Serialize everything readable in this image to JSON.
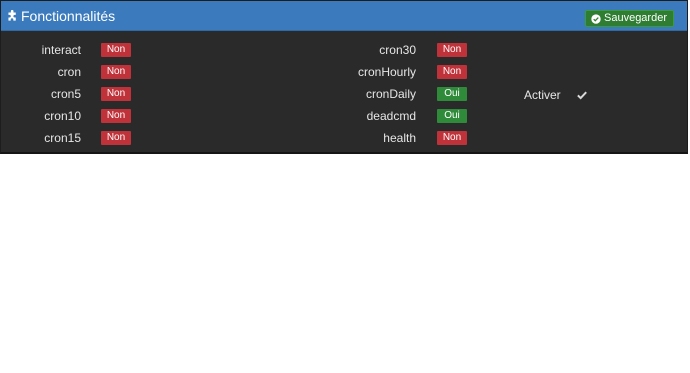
{
  "header": {
    "title": "Fonctionnalités",
    "icon": "puzzle-icon",
    "save_label": "Sauvegarder",
    "save_icon": "check-circle-icon",
    "colors": {
      "header_bg": "#3a7abd",
      "save_bg": "#2e7d32"
    }
  },
  "features_left": [
    {
      "name": "interact",
      "status": "Non"
    },
    {
      "name": "cron",
      "status": "Non"
    },
    {
      "name": "cron5",
      "status": "Non"
    },
    {
      "name": "cron10",
      "status": "Non"
    },
    {
      "name": "cron15",
      "status": "Non"
    }
  ],
  "features_right": [
    {
      "name": "cron30",
      "status": "Non"
    },
    {
      "name": "cronHourly",
      "status": "Non"
    },
    {
      "name": "cronDaily",
      "status": "Oui"
    },
    {
      "name": "deadcmd",
      "status": "Oui"
    },
    {
      "name": "health",
      "status": "Non"
    }
  ],
  "enable": {
    "label": "Activer",
    "checked": true
  },
  "colors": {
    "no": "#c0323a",
    "yes": "#2f8a3a",
    "panel_bg": "#2a2a2a"
  }
}
